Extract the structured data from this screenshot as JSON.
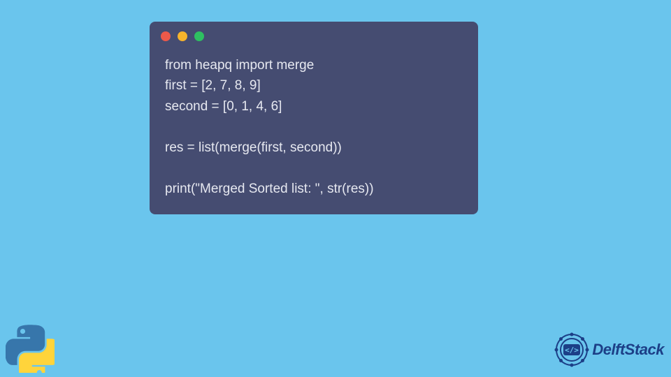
{
  "code": {
    "line1": "from heapq import merge",
    "line2": "first = [2, 7, 8, 9]",
    "line3": "second = [0, 1, 4, 6]",
    "line4": "",
    "line5": "res = list(merge(first, second))",
    "line6": "",
    "line7": "print(\"Merged Sorted list: \", str(res))"
  },
  "brand": {
    "name": "DelftStack"
  },
  "colors": {
    "background": "#6ac5ed",
    "window": "#454c71",
    "dot_red": "#ed594a",
    "dot_yellow": "#f7b42c",
    "dot_green": "#2ec061",
    "brand_text": "#1c3f87"
  }
}
